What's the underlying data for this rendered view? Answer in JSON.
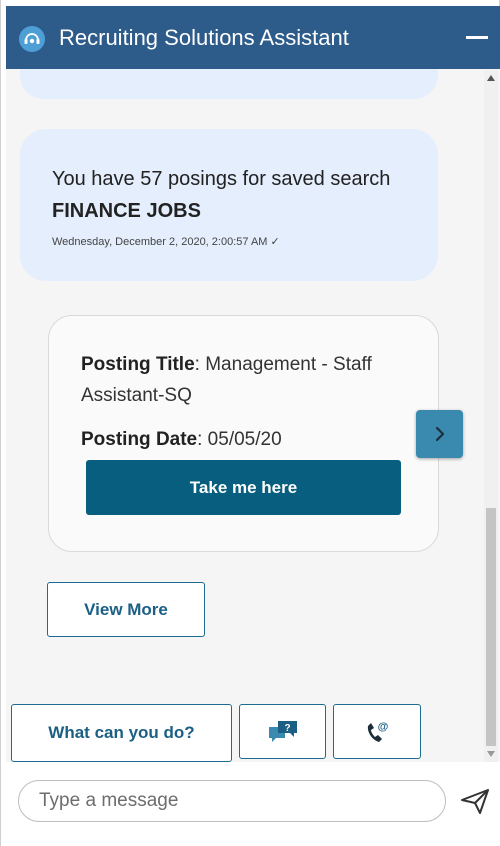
{
  "header": {
    "title": "Recruiting Solutions Assistant",
    "minimize_icon": "minimize-icon",
    "logo_icon": "assistant-headset-icon"
  },
  "message": {
    "text_prefix": "You have 57 posings for saved search ",
    "text_bold": "FINANCE JOBS",
    "timestamp": "Wednesday, December 2, 2020, 2:00:57 AM ✓"
  },
  "card": {
    "title_label": "Posting Title",
    "title_value": ": Management - Staff Assistant-SQ",
    "date_label": "Posting Date",
    "date_value": ": 05/05/20",
    "action_label": "Take me here",
    "next_icon": "chevron-right-icon"
  },
  "view_more_label": "View More",
  "quick_replies": {
    "what_can_you_do": "What can you do?",
    "faq_icon": "chat-question-icon",
    "contact_icon": "phone-email-icon"
  },
  "composer": {
    "placeholder": "Type a message",
    "send_icon": "send-icon"
  },
  "colors": {
    "header_bg": "#2d5b8a",
    "bubble_bg": "#e4eefc",
    "primary_button": "#075e7e",
    "next_button": "#3a8ab0",
    "outline": "#1b6c8f"
  }
}
